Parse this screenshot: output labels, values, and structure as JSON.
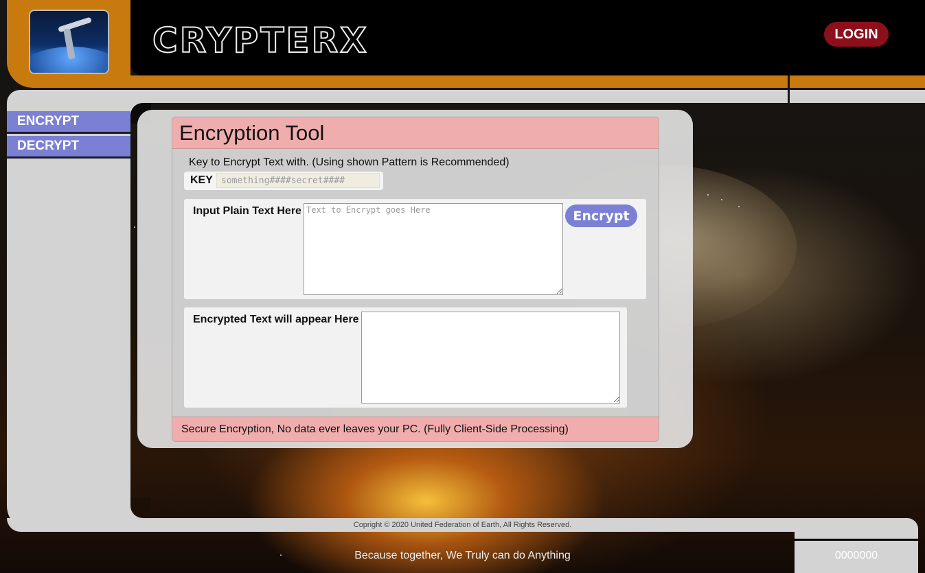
{
  "app": {
    "brand": "CrypterX",
    "login_label": "LOGIN"
  },
  "sidebar": {
    "items": [
      {
        "label": "ENCRYPT"
      },
      {
        "label": "DECRYPT"
      }
    ]
  },
  "tool": {
    "title": "Encryption Tool",
    "key_hint": "Key to Encrypt Text with. (Using shown Pattern is Recommended)",
    "key_label": "KEY",
    "key_placeholder": "something####secret####",
    "key_value": "",
    "input_label": "Input Plain Text Here",
    "input_placeholder": "Text to Encrypt goes Here",
    "input_value": "",
    "encrypt_label": "Encrypt",
    "output_label": "Encrypted Text will appear Here",
    "output_value": "",
    "footer_note": "Secure Encryption, No data ever leaves your PC. (Fully Client-Side Processing)"
  },
  "footer": {
    "copyright": "Copright © 2020 United Federation of Earth, All Rights Reserved.",
    "tagline": "Because together, We Truly can do Anything",
    "counter": "0000000"
  },
  "colors": {
    "lcars_orange": "#c97a0e",
    "lcars_grey": "#d3d3d3",
    "lcars_purple": "#7b80d4",
    "login_red": "#8c0f1c",
    "panel_pink": "#f4aaaa"
  },
  "icons": {
    "logo": "space-station-logo-icon"
  }
}
